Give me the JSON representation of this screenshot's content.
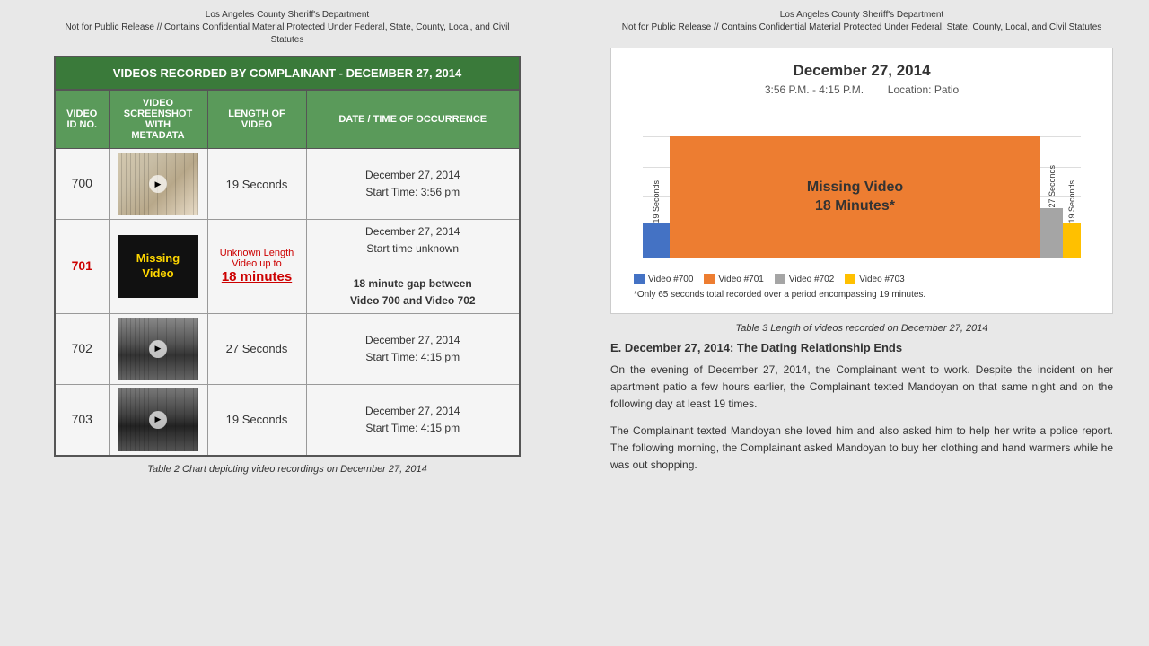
{
  "left": {
    "header_line1": "Los Angeles County Sheriff's Department",
    "header_line2": "Not for Public Release // Contains Confidential Material Protected Under Federal, State, County, Local, and Civil Statutes",
    "table_title": "VIDEOS RECORDED BY COMPLAINANT - DECEMBER 27, 2014",
    "columns": [
      "VIDEO ID NO.",
      "VIDEO SCREENSHOT WITH METADATA",
      "LENGTH OF VIDEO",
      "DATE / TIME OF OCCURRENCE"
    ],
    "rows": [
      {
        "id": "700",
        "id_class": "normal",
        "thumb_type": "700",
        "length": "19 Seconds",
        "date_line1": "December 27, 2014",
        "date_line2": "Start Time: 3:56 pm"
      },
      {
        "id": "701",
        "id_class": "missing",
        "thumb_type": "missing",
        "length_unknown": "Unknown Length",
        "length_upto": "Video up to",
        "length_minutes": "18 minutes",
        "date_line1": "December 27, 2014",
        "date_line2": "Start time unknown",
        "date_line3": "18 minute gap between",
        "date_line4": "Video 700 and Video 702"
      },
      {
        "id": "702",
        "id_class": "normal",
        "thumb_type": "702",
        "length": "27 Seconds",
        "date_line1": "December 27, 2014",
        "date_line2": "Start Time: 4:15 pm"
      },
      {
        "id": "703",
        "id_class": "normal",
        "thumb_type": "703",
        "length": "19 Seconds",
        "date_line1": "December 27, 2014",
        "date_line2": "Start Time: 4:15 pm"
      }
    ],
    "caption": "Table 2 Chart depicting video recordings on December 27, 2014"
  },
  "right": {
    "header_line1": "Los Angeles County Sheriff's Department",
    "header_line2": "Not for Public Release // Contains Confidential Material Protected Under Federal, State, County, Local, and Civil Statutes",
    "chart": {
      "title": "December 27, 2014",
      "subtitle_left": "3:56 P.M. - 4:15 P.M.",
      "subtitle_right": "Location: Patio",
      "bar_label_700": "19 Seconds",
      "bar_label_701_main": "Missing Video\n18 Minutes*",
      "bar_label_702a": "27 Seconds",
      "bar_label_702b": "19 Seconds",
      "legend": [
        {
          "color": "#4472C4",
          "label": "Video #700"
        },
        {
          "color": "#ED7D31",
          "label": "Video #701"
        },
        {
          "color": "#A5A5A5",
          "label": "Video #702"
        },
        {
          "color": "#FFC000",
          "label": "Video #703"
        }
      ],
      "footnote": "*Only 65 seconds total recorded over a period encompassing 19 minutes."
    },
    "table_caption": "Table 3 Length of videos recorded on December 27, 2014",
    "section_heading": "E. December 27, 2014: The Dating Relationship Ends",
    "paragraph1": "On the evening of December 27, 2014, the Complainant went to work.  Despite the incident on her apartment patio a few hours earlier, the Complainant texted Mandoyan on that same night and on the following day at least 19 times.",
    "paragraph2": "The Complainant texted Mandoyan she loved him and also asked him to help her write a police report.  The following morning, the Complainant asked Mandoyan to buy her clothing and hand warmers while he was out shopping."
  }
}
